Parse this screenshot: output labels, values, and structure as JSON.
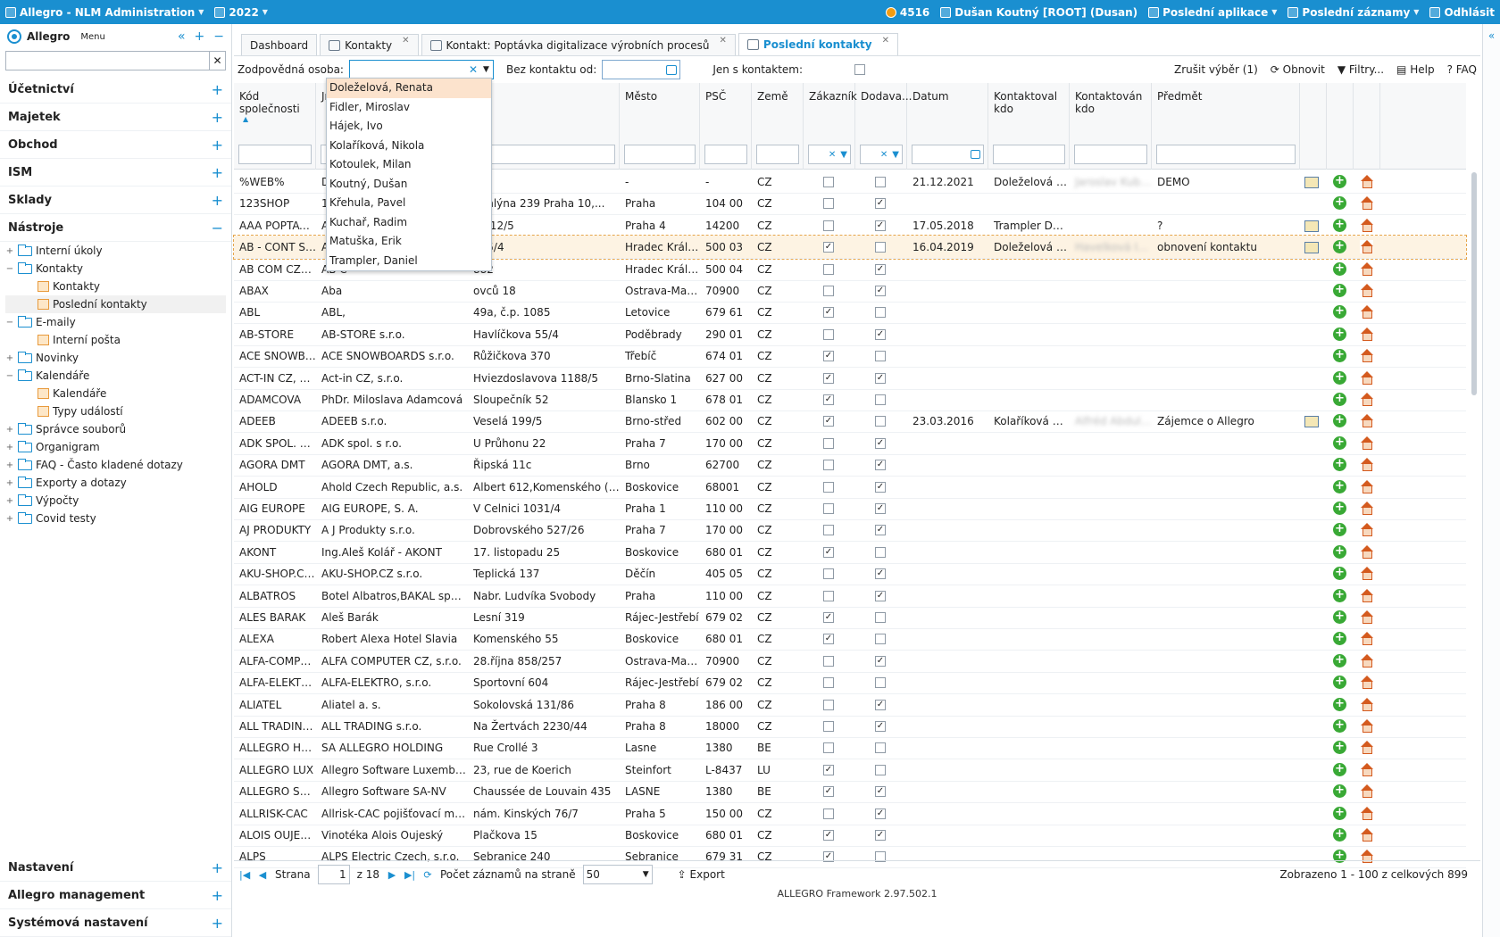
{
  "topbar": {
    "app": "Allegro - NLM Administration",
    "year": "2022",
    "count": "4516",
    "user": "Dušan Koutný [ROOT] (Dusan)",
    "recent_apps": "Poslední aplikace",
    "recent_records": "Poslední záznamy",
    "logout": "Odhlásit"
  },
  "sidebar": {
    "logo": "Allegro",
    "menu_label": "Menu",
    "sections_top": [
      "Účetnictví",
      "Majetek",
      "Obchod",
      "ISM",
      "Sklady"
    ],
    "section_open": "Nástroje",
    "tree": [
      {
        "label": "Interní úkoly",
        "level": 0,
        "toggle": "+",
        "icon": "folder"
      },
      {
        "label": "Kontakty",
        "level": 0,
        "toggle": "−",
        "icon": "folder"
      },
      {
        "label": "Kontakty",
        "level": 1,
        "toggle": "",
        "icon": "leaf"
      },
      {
        "label": "Poslední kontakty",
        "level": 1,
        "toggle": "",
        "icon": "leaf",
        "selected": true
      },
      {
        "label": "E-maily",
        "level": 0,
        "toggle": "−",
        "icon": "folder"
      },
      {
        "label": "Interní pošta",
        "level": 1,
        "toggle": "",
        "icon": "leaf"
      },
      {
        "label": "Novinky",
        "level": 0,
        "toggle": "+",
        "icon": "folder"
      },
      {
        "label": "Kalendáře",
        "level": 0,
        "toggle": "−",
        "icon": "folder"
      },
      {
        "label": "Kalendáře",
        "level": 1,
        "toggle": "",
        "icon": "leaf"
      },
      {
        "label": "Typy událostí",
        "level": 1,
        "toggle": "",
        "icon": "leaf"
      },
      {
        "label": "Správce souborů",
        "level": 0,
        "toggle": "+",
        "icon": "folder"
      },
      {
        "label": "Organigram",
        "level": 0,
        "toggle": "+",
        "icon": "folder"
      },
      {
        "label": "FAQ - Často kladené dotazy",
        "level": 0,
        "toggle": "+",
        "icon": "folder"
      },
      {
        "label": "Exporty a dotazy",
        "level": 0,
        "toggle": "+",
        "icon": "folder"
      },
      {
        "label": "Výpočty",
        "level": 0,
        "toggle": "+",
        "icon": "folder"
      },
      {
        "label": "Covid testy",
        "level": 0,
        "toggle": "+",
        "icon": "folder"
      }
    ],
    "sections_bottom": [
      "Nastavení",
      "Allegro management",
      "Systémová nastavení"
    ]
  },
  "tabs": [
    {
      "label": "Dashboard"
    },
    {
      "label": "Kontakty",
      "closable": true
    },
    {
      "label": "Kontakt: Poptávka digitalizace výrobních procesů",
      "closable": true
    },
    {
      "label": "Poslední kontakty",
      "closable": true,
      "active": true
    }
  ],
  "filter": {
    "person_label": "Zodpovědná osoba:",
    "nocontact_label": "Bez kontaktu od:",
    "only_label": "Jen s kontaktem:",
    "clear": "Zrušit výběr (1)",
    "refresh": "Obnovit",
    "filters": "Filtry...",
    "help": "Help",
    "faq": "FAQ"
  },
  "dropdown": [
    "Doleželová, Renata",
    "Fidler, Miroslav",
    "Hájek, Ivo",
    "Kolaříková, Nikola",
    "Kotoulek, Milan",
    "Koutný, Dušan",
    "Křehula, Pavel",
    "Kuchař, Radim",
    "Matuška, Erik",
    "Trampler, Daniel"
  ],
  "headers": [
    "Kód společnosti",
    "Jméno",
    "",
    "Město",
    "PSČ",
    "Země",
    "Zákazník",
    "Dodava...",
    "Datum",
    "Kontaktoval kdo",
    "Kontaktován kdo",
    "Předmět"
  ],
  "rows": [
    [
      "%WEB%",
      "Dem",
      "",
      "-",
      "-",
      "CZ",
      0,
      0,
      "21.12.2021",
      "Doleželová Re...",
      "Jaroslav Kubíček",
      "DEMO",
      1
    ],
    [
      "123SHOP",
      "123s",
      "o mlýna 239 Praha 10,...",
      "Praha",
      "104 00",
      "CZ",
      0,
      1,
      "",
      "",
      "",
      "",
      0
    ],
    [
      "AAA POPTAVKA",
      "AAA",
      "a 512/5",
      "Praha 4",
      "14200",
      "CZ",
      0,
      1,
      "17.05.2018",
      "Trampler Daniel",
      "",
      "?",
      1
    ],
    [
      "AB - CONT S.R...",
      "AB -",
      "465/4",
      "Hradec Králové",
      "500 03",
      "CZ",
      1,
      0,
      "16.04.2019",
      "Doleželová Re...",
      "Havelková Ivana",
      "obnovení kontaktu",
      1
    ],
    [
      "AB COM CZECH",
      "AB C",
      "882",
      "Hradec Králov...",
      "500 04",
      "CZ",
      0,
      1,
      "",
      "",
      "",
      "",
      0
    ],
    [
      "ABAX",
      "Aba",
      "ovců 18",
      "Ostrava-Mariá...",
      "70900",
      "CZ",
      0,
      1,
      "",
      "",
      "",
      "",
      0
    ],
    [
      "ABL",
      "ABL,",
      "49a, č.p. 1085",
      "Letovice",
      "679 61",
      "CZ",
      1,
      0,
      "",
      "",
      "",
      "",
      0
    ],
    [
      "AB-STORE",
      "AB-STORE s.r.o.",
      "Havlíčkova 55/4",
      "Poděbrady",
      "290 01",
      "CZ",
      0,
      1,
      "",
      "",
      "",
      "",
      0
    ],
    [
      "ACE SNOWBOA...",
      "ACE SNOWBOARDS s.r.o.",
      "Růžičkova 370",
      "Třebíč",
      "674 01",
      "CZ",
      1,
      0,
      "",
      "",
      "",
      "",
      0
    ],
    [
      "ACT-IN CZ, S.R...",
      "Act-in CZ, s.r.o.",
      "Hviezdoslavova 1188/5",
      "Brno-Slatina",
      "627 00",
      "CZ",
      1,
      1,
      "",
      "",
      "",
      "",
      0
    ],
    [
      "ADAMCOVA",
      "PhDr. Miloslava Adamcová",
      "Sloupečník 52",
      "Blansko 1",
      "678 01",
      "CZ",
      1,
      0,
      "",
      "",
      "",
      "",
      0
    ],
    [
      "ADEEB",
      "ADEEB s.r.o.",
      "Veselá 199/5",
      "Brno-střed",
      "602 00",
      "CZ",
      1,
      0,
      "23.03.2016",
      "Kolaříková Nik...",
      "Alfréd Abdul...",
      "Zájemce o Allegro",
      1
    ],
    [
      "ADK SPOL. S R.O.",
      "ADK spol. s r.o.",
      "U Průhonu 22",
      "Praha 7",
      "170 00",
      "CZ",
      0,
      1,
      "",
      "",
      "",
      "",
      0
    ],
    [
      "AGORA DMT",
      "AGORA DMT, a.s.",
      "Řipská 11c",
      "Brno",
      "62700",
      "CZ",
      0,
      1,
      "",
      "",
      "",
      "",
      0
    ],
    [
      "AHOLD",
      "Ahold Czech Republic, a.s.",
      "Albert 612,Komenského (Radli...",
      "Boskovice",
      "68001",
      "CZ",
      0,
      1,
      "",
      "",
      "",
      "",
      0
    ],
    [
      "AIG EUROPE",
      "AIG EUROPE, S. A.",
      "V Celnici 1031/4",
      "Praha 1",
      "110 00",
      "CZ",
      0,
      1,
      "",
      "",
      "",
      "",
      0
    ],
    [
      "AJ PRODUKTY",
      "A J Produkty s.r.o.",
      "Dobrovského 527/26",
      "Praha 7",
      "170 00",
      "CZ",
      0,
      1,
      "",
      "",
      "",
      "",
      0
    ],
    [
      "AKONT",
      "Ing.Aleš Kolář - AKONT",
      "17. listopadu 25",
      "Boskovice",
      "680 01",
      "CZ",
      1,
      0,
      "",
      "",
      "",
      "",
      0
    ],
    [
      "AKU-SHOP.CZ ...",
      "AKU-SHOP.CZ s.r.o.",
      "Teplická 137",
      "Děčín",
      "405 05",
      "CZ",
      0,
      1,
      "",
      "",
      "",
      "",
      0
    ],
    [
      "ALBATROS",
      "Botel Albatros,BAKAL spol. s r.o.",
      "Nabr. Ludvíka Svobody",
      "Praha",
      "110 00",
      "CZ",
      0,
      1,
      "",
      "",
      "",
      "",
      0
    ],
    [
      "ALES BARAK",
      "Aleš Barák",
      "Lesní 319",
      "Rájec-Jestřebí",
      "679 02",
      "CZ",
      1,
      0,
      "",
      "",
      "",
      "",
      0
    ],
    [
      "ALEXA",
      "Robert Alexa Hotel Slavia",
      "Komenského 55",
      "Boskovice",
      "680 01",
      "CZ",
      1,
      0,
      "",
      "",
      "",
      "",
      0
    ],
    [
      "ALFA-COMPUT...",
      "ALFA COMPUTER CZ, s.r.o.",
      "28.října 858/257",
      "Ostrava-Mar.H...",
      "70900",
      "CZ",
      0,
      1,
      "",
      "",
      "",
      "",
      0
    ],
    [
      "ALFA-ELEKTRO",
      "ALFA-ELEKTRO, s.r.o.",
      "Sportovní 604",
      "Rájec-Jestřebí",
      "679 02",
      "CZ",
      0,
      0,
      "",
      "",
      "",
      "",
      0
    ],
    [
      "ALIATEL",
      "Aliatel a. s.",
      "Sokolovská 131/86",
      "Praha 8",
      "186 00",
      "CZ",
      0,
      1,
      "",
      "",
      "",
      "",
      0
    ],
    [
      "ALL TRADING S...",
      "ALL TRADING s.r.o.",
      "Na Žertvách 2230/44",
      "Praha 8",
      "18000",
      "CZ",
      0,
      1,
      "",
      "",
      "",
      "",
      0
    ],
    [
      "ALLEGRO HOLDI...",
      "SA ALLEGRO HOLDING",
      "Rue Crollé 3",
      "Lasne",
      "1380",
      "BE",
      0,
      0,
      "",
      "",
      "",
      "",
      0
    ],
    [
      "ALLEGRO LUX",
      "Allegro Software Luxembourg ...",
      "23, rue de Koerich",
      "Steinfort",
      "L-8437",
      "LU",
      1,
      0,
      "",
      "",
      "",
      "",
      0
    ],
    [
      "ALLEGRO SOFT...",
      "Allegro Software SA-NV",
      "Chaussée de Louvain 435",
      "LASNE",
      "1380",
      "BE",
      1,
      1,
      "",
      "",
      "",
      "",
      0
    ],
    [
      "ALLRISK-CAC",
      "Allrisk-CAC pojišťovací maklé...",
      "nám. Kinských 76/7",
      "Praha 5",
      "150 00",
      "CZ",
      0,
      1,
      "",
      "",
      "",
      "",
      0
    ],
    [
      "ALOIS OUJESKY",
      "Vinotéka Alois Oujeský",
      "Plačkova 15",
      "Boskovice",
      "680 01",
      "CZ",
      1,
      1,
      "",
      "",
      "",
      "",
      0
    ],
    [
      "ALPS",
      "ALPS Electric Czech, s.r.o.",
      "Sebranice 240",
      "Sebranice",
      "679 31",
      "CZ",
      1,
      0,
      "",
      "",
      "",
      "",
      0
    ]
  ],
  "pager": {
    "page_label": "Strana",
    "page": "1",
    "of": "z 18",
    "per_page_label": "Počet záznamů na straně",
    "per_page": "50",
    "export": "Export",
    "summary": "Zobrazeno 1 - 100 z celkových 899"
  },
  "footer": "ALLEGRO Framework 2.97.502.1"
}
